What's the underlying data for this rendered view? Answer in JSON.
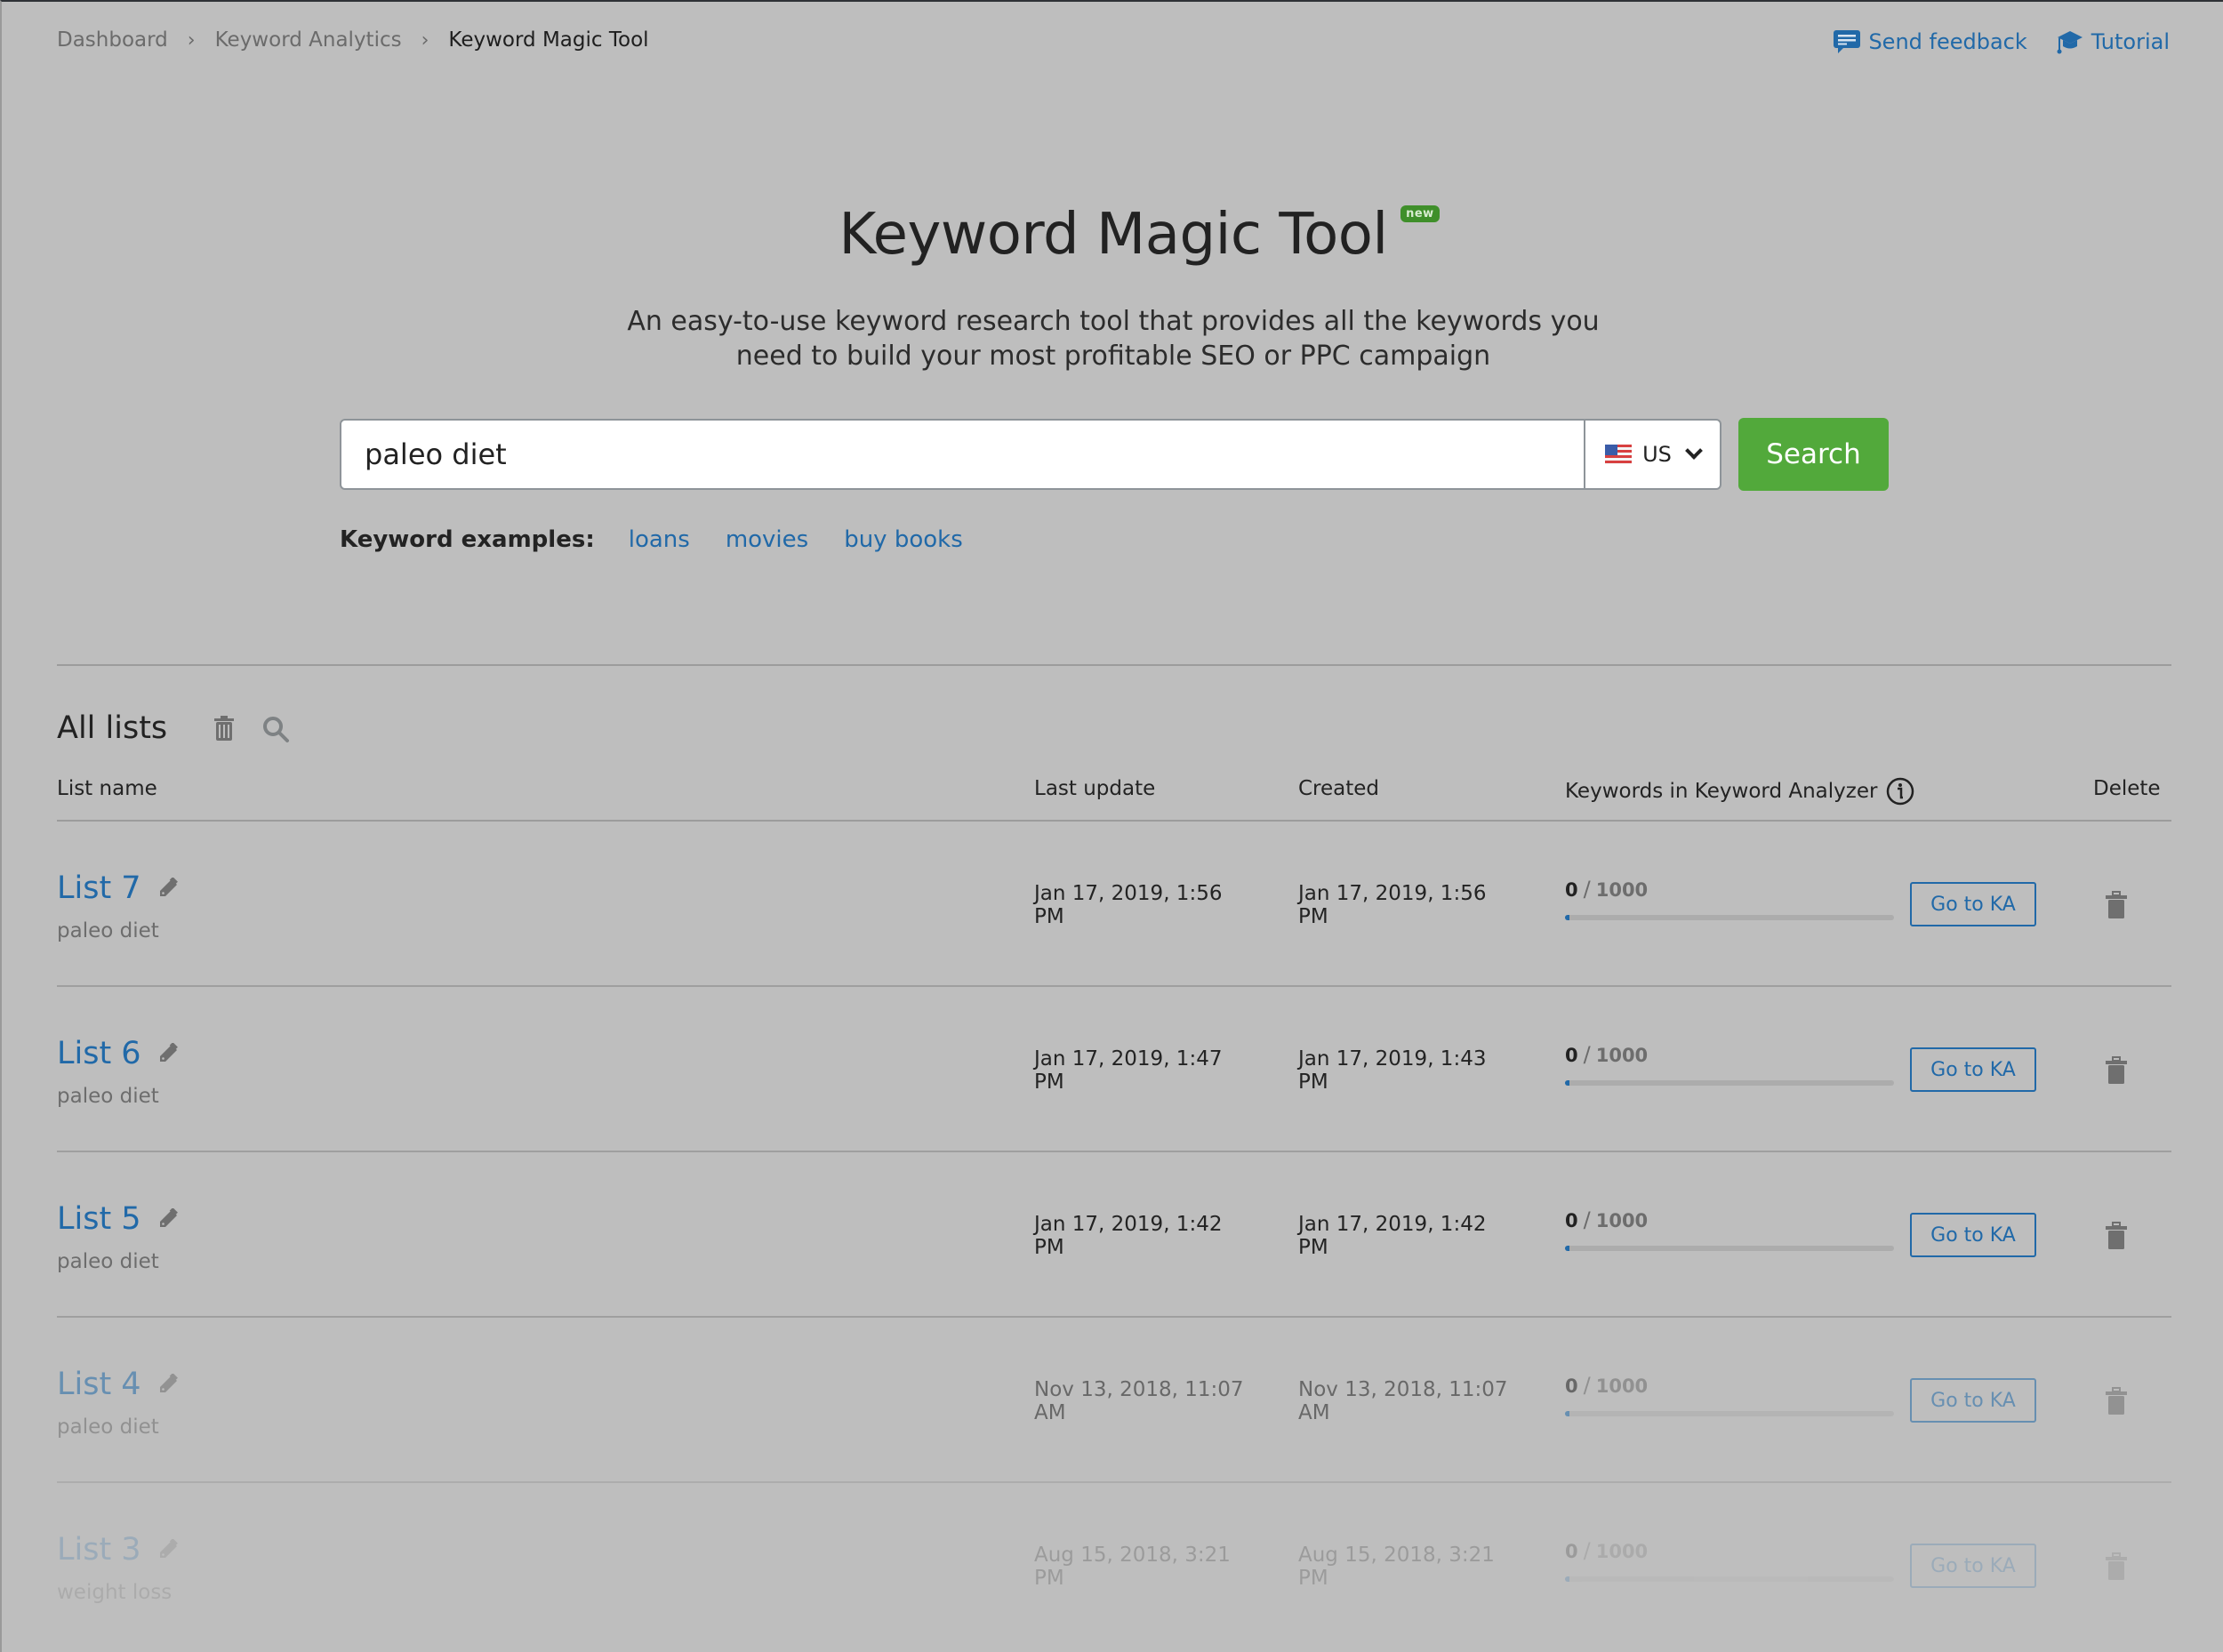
{
  "breadcrumb": {
    "items": [
      "Dashboard",
      "Keyword Analytics",
      "Keyword Magic Tool"
    ]
  },
  "top_links": {
    "feedback": "Send feedback",
    "tutorial": "Tutorial"
  },
  "hero": {
    "title": "Keyword Magic Tool",
    "badge": "new",
    "subtitle_line1": "An easy-to-use keyword research tool that provides all the keywords you",
    "subtitle_line2": "need to build your most profitable SEO or PPC campaign"
  },
  "search": {
    "value": "paleo diet",
    "placeholder": "",
    "database": "US",
    "button_label": "Search"
  },
  "examples": {
    "label": "Keyword examples:",
    "items": [
      "loans",
      "movies",
      "buy books"
    ]
  },
  "lists": {
    "title": "All lists",
    "columns": {
      "name": "List name",
      "last_update": "Last update",
      "created": "Created",
      "keywords": "Keywords in Keyword Analyzer",
      "delete": "Delete"
    },
    "go_label": "Go to KA",
    "rows": [
      {
        "name": "List 7",
        "keyword": "paleo diet",
        "last_update": "Jan 17, 2019, 1:56 PM",
        "created": "Jan 17, 2019, 1:56 PM",
        "count": "0",
        "max": "1000",
        "progress": 0
      },
      {
        "name": "List 6",
        "keyword": "paleo diet",
        "last_update": "Jan 17, 2019, 1:47 PM",
        "created": "Jan 17, 2019, 1:43 PM",
        "count": "0",
        "max": "1000",
        "progress": 0
      },
      {
        "name": "List 5",
        "keyword": "paleo diet",
        "last_update": "Jan 17, 2019, 1:42 PM",
        "created": "Jan 17, 2019, 1:42 PM",
        "count": "0",
        "max": "1000",
        "progress": 0
      },
      {
        "name": "List 4",
        "keyword": "paleo diet",
        "last_update": "Nov 13, 2018, 11:07 AM",
        "created": "Nov 13, 2018, 11:07 AM",
        "count": "0",
        "max": "1000",
        "progress": 0
      },
      {
        "name": "List 3",
        "keyword": "weight loss",
        "last_update": "Aug 15, 2018, 3:21 PM",
        "created": "Aug 15, 2018, 3:21 PM",
        "count": "0",
        "max": "1000",
        "progress": 0
      }
    ]
  },
  "colors": {
    "accent_blue": "#2169a8",
    "search_green": "#52a93b",
    "badge_green": "#3f8f2a",
    "overlay_gray": "#bebebe"
  }
}
